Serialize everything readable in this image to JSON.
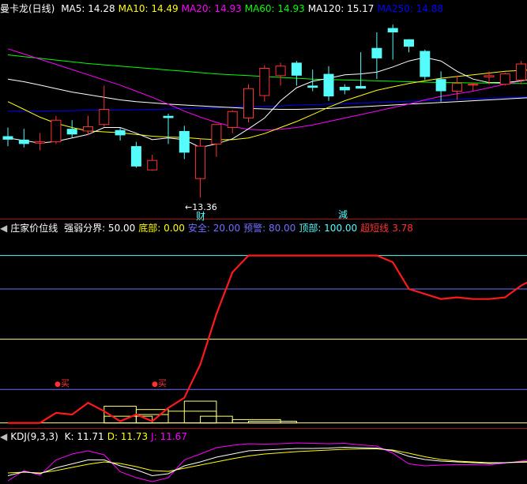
{
  "colors": {
    "bg": "#000000",
    "up": "#ff3232",
    "down": "#54fcfc",
    "ma5": "#ffffff",
    "ma10": "#ffff00",
    "ma20": "#ff00ff",
    "ma60": "#00ff00",
    "ma120": "#ffffff",
    "ma250": "#0000ff",
    "ind_line": "#ff1a1a",
    "ref_blue": "#6f6fff",
    "ref_yellow": "#ffff80",
    "ref_cyan": "#54fcfc",
    "kdj_k": "#ffffff",
    "kdj_d": "#ffff00",
    "kdj_j": "#ff00ff",
    "separator": "#a01010"
  },
  "price_header": {
    "title": "曼卡龙(日线)",
    "ma": [
      {
        "label": "MA5: 14.28",
        "color": "#ffffff"
      },
      {
        "label": "MA10: 14.49",
        "color": "#ffff00"
      },
      {
        "label": "MA20: 14.93",
        "color": "#ff00ff"
      },
      {
        "label": "MA60: 14.93",
        "color": "#00ff00"
      },
      {
        "label": "MA120: 15.17",
        "color": "#ffffff"
      },
      {
        "label": "MA250: 14.88",
        "color": "#0000ff"
      }
    ]
  },
  "indicator_header": {
    "title": "庄家价位线",
    "items": [
      {
        "label": "强弱分界: 50.00",
        "color": "#ffffff"
      },
      {
        "label": "底部: 0.00",
        "color": "#ffff00"
      },
      {
        "label": "安全: 20.00",
        "color": "#6f6fff"
      },
      {
        "label": "预警: 80.00",
        "color": "#6f6fff"
      },
      {
        "label": "顶部: 100.00",
        "color": "#54fcfc"
      },
      {
        "label": "超短线",
        "color": "#ff3232"
      },
      {
        "label": "3.78",
        "color": "#ff3232"
      }
    ]
  },
  "kdj_header": {
    "title": "KDJ(9,3,3)",
    "items": [
      {
        "label": "K: 11.71",
        "color": "#ffffff"
      },
      {
        "label": "D: 11.73",
        "color": "#ffff00"
      },
      {
        "label": "J: 11.67",
        "color": "#ff00ff"
      }
    ]
  },
  "markers": {
    "low_price": "13.36",
    "cai": "财",
    "jian": "減",
    "buy": "买"
  },
  "chart_data": [
    {
      "type": "candlestick",
      "title": "曼卡龙(日线)",
      "y_range": [
        13.0,
        17.6
      ],
      "min_label": 13.36,
      "candles": [
        {
          "o": 14.78,
          "h": 14.98,
          "l": 14.55,
          "c": 14.7
        },
        {
          "o": 14.7,
          "h": 14.95,
          "l": 14.52,
          "c": 14.6
        },
        {
          "o": 14.62,
          "h": 14.85,
          "l": 14.45,
          "c": 14.65
        },
        {
          "o": 14.65,
          "h": 15.25,
          "l": 14.6,
          "c": 15.15
        },
        {
          "o": 14.95,
          "h": 15.15,
          "l": 14.75,
          "c": 14.82
        },
        {
          "o": 14.9,
          "h": 15.25,
          "l": 14.8,
          "c": 15.0
        },
        {
          "o": 15.05,
          "h": 15.95,
          "l": 15.0,
          "c": 15.4
        },
        {
          "o": 14.92,
          "h": 14.98,
          "l": 14.68,
          "c": 14.8
        },
        {
          "o": 14.55,
          "h": 14.65,
          "l": 14.05,
          "c": 14.08
        },
        {
          "o": 14.0,
          "h": 14.35,
          "l": 13.98,
          "c": 14.22
        },
        {
          "o": 15.25,
          "h": 15.3,
          "l": 14.6,
          "c": 15.2
        },
        {
          "o": 14.9,
          "h": 15.02,
          "l": 14.25,
          "c": 14.4
        },
        {
          "o": 13.8,
          "h": 14.72,
          "l": 13.36,
          "c": 14.55
        },
        {
          "o": 14.6,
          "h": 14.98,
          "l": 14.3,
          "c": 15.05
        },
        {
          "o": 14.98,
          "h": 15.38,
          "l": 14.85,
          "c": 15.35
        },
        {
          "o": 15.2,
          "h": 15.98,
          "l": 15.1,
          "c": 15.88
        },
        {
          "o": 15.72,
          "h": 16.42,
          "l": 15.58,
          "c": 16.35
        },
        {
          "o": 16.18,
          "h": 16.48,
          "l": 15.95,
          "c": 16.4
        },
        {
          "o": 16.48,
          "h": 16.52,
          "l": 15.95,
          "c": 16.18
        },
        {
          "o": 15.95,
          "h": 16.32,
          "l": 15.82,
          "c": 15.9
        },
        {
          "o": 16.22,
          "h": 16.4,
          "l": 15.6,
          "c": 15.7
        },
        {
          "o": 15.92,
          "h": 15.98,
          "l": 15.75,
          "c": 15.84
        },
        {
          "o": 15.94,
          "h": 16.72,
          "l": 15.94,
          "c": 15.88
        },
        {
          "o": 16.82,
          "h": 17.18,
          "l": 16.1,
          "c": 16.58
        },
        {
          "o": 17.28,
          "h": 17.36,
          "l": 16.55,
          "c": 17.18
        },
        {
          "o": 17.02,
          "h": 16.98,
          "l": 16.72,
          "c": 16.85
        },
        {
          "o": 16.75,
          "h": 16.78,
          "l": 16.08,
          "c": 16.15
        },
        {
          "o": 16.1,
          "h": 16.28,
          "l": 15.58,
          "c": 15.82
        },
        {
          "o": 15.82,
          "h": 16.18,
          "l": 15.62,
          "c": 16.0
        },
        {
          "o": 15.98,
          "h": 16.02,
          "l": 15.82,
          "c": 15.98
        },
        {
          "o": 16.15,
          "h": 16.28,
          "l": 15.98,
          "c": 16.18
        },
        {
          "o": 15.98,
          "h": 16.25,
          "l": 15.95,
          "c": 16.22
        },
        {
          "o": 16.08,
          "h": 16.52,
          "l": 15.98,
          "c": 16.45
        },
        {
          "o": 16.02,
          "h": 16.42,
          "l": 15.92,
          "c": 16.38
        },
        {
          "o": 16.08,
          "h": 16.62,
          "l": 16.05,
          "c": 16.98
        },
        {
          "o": 16.88,
          "h": 17.52,
          "l": 16.5,
          "c": 17.18
        },
        {
          "o": 17.35,
          "h": 17.42,
          "l": 16.58,
          "c": 16.62
        }
      ],
      "series": [
        {
          "name": "MA5",
          "values": [
            14.74,
            14.68,
            14.62,
            14.66,
            14.74,
            14.82,
            14.98,
            14.98,
            14.85,
            14.7,
            14.74,
            14.7,
            14.52,
            14.6,
            14.72,
            14.95,
            15.2,
            15.6,
            15.9,
            16.05,
            16.12,
            16.2,
            16.22,
            16.26,
            16.38,
            16.52,
            16.6,
            16.52,
            16.28,
            16.1,
            16.02,
            16.02,
            16.06,
            16.12,
            16.3,
            16.52,
            16.82
          ]
        },
        {
          "name": "MA10",
          "values": [
            15.58,
            15.4,
            15.22,
            15.08,
            14.98,
            14.9,
            14.88,
            14.86,
            14.82,
            14.78,
            14.76,
            14.75,
            14.72,
            14.7,
            14.7,
            14.74,
            14.84,
            14.98,
            15.12,
            15.28,
            15.45,
            15.6,
            15.72,
            15.84,
            15.92,
            16.0,
            16.06,
            16.12,
            16.16,
            16.2,
            16.24,
            16.28,
            16.3,
            16.32,
            16.36,
            16.42,
            16.5
          ]
        },
        {
          "name": "MA20",
          "values": [
            16.8,
            16.68,
            16.56,
            16.44,
            16.32,
            16.2,
            16.08,
            15.96,
            15.82,
            15.68,
            15.52,
            15.36,
            15.22,
            15.1,
            15.0,
            14.94,
            14.92,
            14.94,
            14.98,
            15.04,
            15.12,
            15.2,
            15.28,
            15.36,
            15.44,
            15.52,
            15.62,
            15.7,
            15.76,
            15.82,
            15.9,
            15.98,
            16.06,
            16.12,
            16.2,
            16.28,
            16.36
          ]
        },
        {
          "name": "MA60",
          "values": [
            16.66,
            16.62,
            16.58,
            16.54,
            16.5,
            16.46,
            16.43,
            16.4,
            16.37,
            16.34,
            16.31,
            16.28,
            16.25,
            16.22,
            16.2,
            16.18,
            16.16,
            16.14,
            16.12,
            16.1,
            16.09,
            16.08,
            16.07,
            16.06,
            16.05,
            16.04,
            16.03,
            16.02,
            16.02,
            16.01,
            16.01,
            16.0,
            16.0,
            16.0,
            16.0,
            16.0,
            16.0
          ]
        },
        {
          "name": "MA120",
          "values": [
            16.1,
            16.04,
            15.96,
            15.88,
            15.8,
            15.74,
            15.68,
            15.62,
            15.58,
            15.55,
            15.52,
            15.5,
            15.48,
            15.46,
            15.44,
            15.42,
            15.41,
            15.4,
            15.4,
            15.41,
            15.42,
            15.44,
            15.46,
            15.48,
            15.5,
            15.52,
            15.54,
            15.56,
            15.58,
            15.6,
            15.62,
            15.64,
            15.66,
            15.68,
            15.7,
            15.72,
            15.74
          ]
        },
        {
          "name": "MA250",
          "values": [
            15.36,
            15.36,
            15.36,
            15.37,
            15.37,
            15.38,
            15.38,
            15.39,
            15.39,
            15.4,
            15.41,
            15.42,
            15.43,
            15.44,
            15.45,
            15.46,
            15.47,
            15.48,
            15.5,
            15.51,
            15.52,
            15.53,
            15.55,
            15.56,
            15.57,
            15.59,
            15.6,
            15.62,
            15.63,
            15.64,
            15.66,
            15.67,
            15.68,
            15.7,
            15.71,
            15.72,
            15.74
          ]
        }
      ]
    },
    {
      "type": "line",
      "title": "庄家价位线",
      "y_range": [
        -3,
        113
      ],
      "reference_lines": [
        {
          "name": "底部",
          "y": 0
        },
        {
          "name": "安全",
          "y": 20
        },
        {
          "name": "强弱分界",
          "y": 50
        },
        {
          "name": "预警",
          "y": 80
        },
        {
          "name": "顶部",
          "y": 100
        }
      ],
      "series": [
        {
          "name": "庄家价位线",
          "values": [
            0,
            0,
            0,
            6,
            5,
            12,
            7,
            1,
            5,
            1,
            9,
            15,
            35,
            65,
            90,
            100,
            100,
            100,
            100,
            100,
            100,
            100,
            100,
            100,
            96,
            80,
            77,
            74,
            75,
            74,
            74,
            75,
            82,
            87,
            91,
            88,
            90
          ]
        }
      ],
      "bars": [
        {
          "bottom": 0,
          "top": 4,
          "start": 6,
          "end": 9
        },
        {
          "bottom": 0,
          "top": 10,
          "start": 6,
          "end": 8
        },
        {
          "bottom": 0,
          "top": 8,
          "start": 8,
          "end": 10
        },
        {
          "bottom": 0,
          "top": 5,
          "start": 8,
          "end": 10
        },
        {
          "bottom": 0,
          "top": 7,
          "start": 10,
          "end": 13
        },
        {
          "bottom": 0,
          "top": 13,
          "start": 11,
          "end": 13
        },
        {
          "bottom": 0,
          "top": 4,
          "start": 12,
          "end": 14
        },
        {
          "bottom": 0,
          "top": 2,
          "start": 14,
          "end": 17
        },
        {
          "bottom": 0,
          "top": 1,
          "start": 15,
          "end": 18
        }
      ],
      "buy_signals": [
        3,
        9
      ]
    },
    {
      "type": "line",
      "title": "KDJ(9,3,3)",
      "y_range": [
        0,
        100
      ],
      "series": [
        {
          "name": "K",
          "values": [
            15,
            25,
            20,
            35,
            45,
            55,
            55,
            40,
            30,
            15,
            20,
            40,
            50,
            62,
            70,
            78,
            80,
            82,
            84,
            84,
            85,
            87,
            86,
            85,
            78,
            64,
            56,
            52,
            50,
            48,
            46,
            48,
            50,
            52,
            56,
            63,
            70
          ]
        },
        {
          "name": "D",
          "values": [
            22,
            24,
            22,
            28,
            36,
            44,
            50,
            46,
            38,
            28,
            26,
            34,
            42,
            50,
            58,
            65,
            70,
            73,
            76,
            78,
            80,
            82,
            83,
            83,
            80,
            72,
            63,
            56,
            52,
            50,
            48,
            48,
            49,
            50,
            52,
            56,
            61
          ]
        },
        {
          "name": "J",
          "values": [
            2,
            28,
            16,
            55,
            70,
            78,
            68,
            25,
            10,
            0,
            10,
            55,
            70,
            86,
            92,
            96,
            95,
            96,
            98,
            97,
            96,
            97,
            93,
            90,
            72,
            45,
            40,
            42,
            43,
            43,
            42,
            47,
            52,
            58,
            68,
            82,
            90
          ]
        }
      ]
    }
  ]
}
